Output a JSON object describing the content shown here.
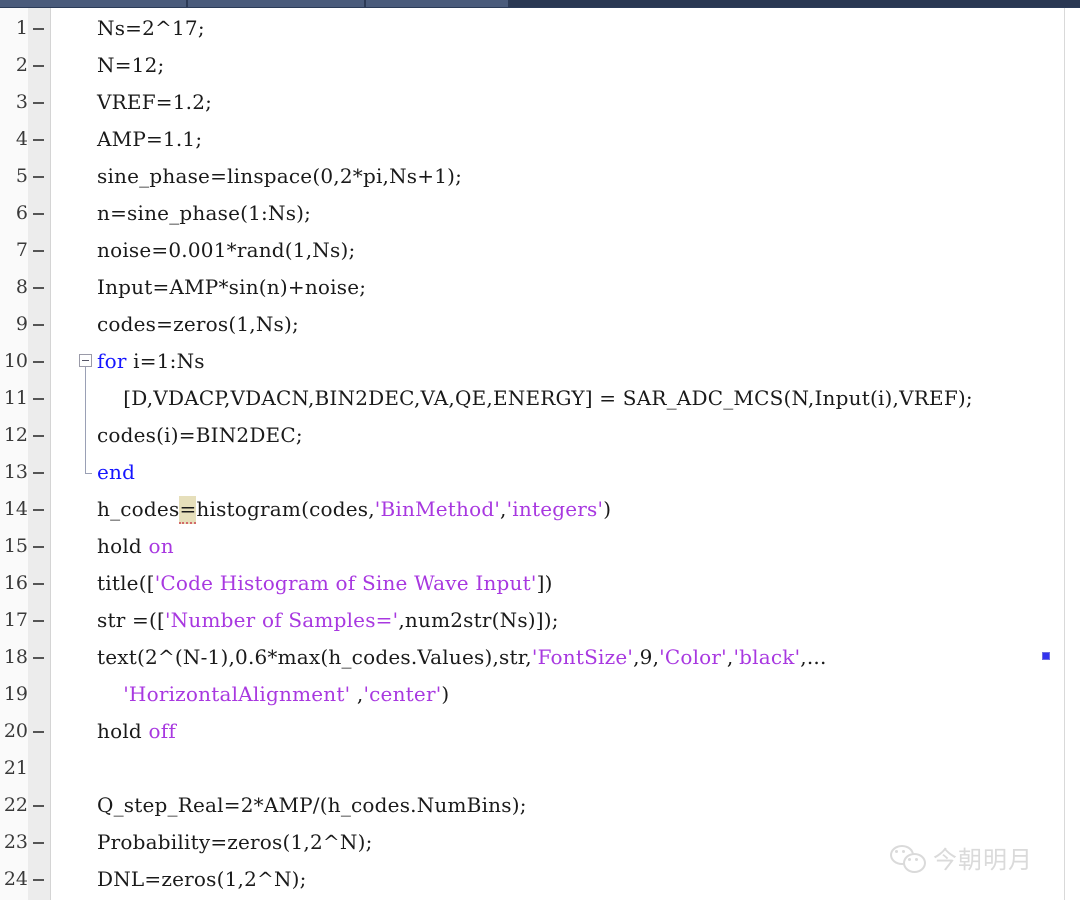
{
  "window": {
    "app": "MATLAB Editor",
    "toolbar_accent": "#485978",
    "toolbar_accent_dark": "#293752"
  },
  "editor": {
    "background": "#ffffff",
    "gutter_background": "#ececec",
    "keyword_color": "#1515ff",
    "string_color": "#a838e0",
    "text_color": "#1a1a1a",
    "highlight_background": "#e6dfbb",
    "error_underline_color": "#d26a6a"
  },
  "analyzer": {
    "marker_color": "#3333ee",
    "marker_label": "code-analyzer-marker"
  },
  "watermark": {
    "icon": "wechat-icon",
    "text": "今朝明月"
  },
  "lines": [
    {
      "n": "1",
      "dash": true,
      "indent": 0,
      "tokens": [
        {
          "t": "Ns=2^17;",
          "c": "plain"
        }
      ]
    },
    {
      "n": "2",
      "dash": true,
      "indent": 0,
      "tokens": [
        {
          "t": "N=12;",
          "c": "plain"
        }
      ]
    },
    {
      "n": "3",
      "dash": true,
      "indent": 0,
      "tokens": [
        {
          "t": "VREF=1.2;",
          "c": "plain"
        }
      ]
    },
    {
      "n": "4",
      "dash": true,
      "indent": 0,
      "tokens": [
        {
          "t": "AMP=1.1;",
          "c": "plain"
        }
      ]
    },
    {
      "n": "5",
      "dash": true,
      "indent": 0,
      "tokens": [
        {
          "t": "sine_phase=linspace(0,2*pi,Ns+1);",
          "c": "plain"
        }
      ]
    },
    {
      "n": "6",
      "dash": true,
      "indent": 0,
      "tokens": [
        {
          "t": "n=sine_phase(1:Ns);",
          "c": "plain"
        }
      ]
    },
    {
      "n": "7",
      "dash": true,
      "indent": 0,
      "tokens": [
        {
          "t": "noise=0.001*rand(1,Ns);",
          "c": "plain"
        }
      ]
    },
    {
      "n": "8",
      "dash": true,
      "indent": 0,
      "tokens": [
        {
          "t": "Input=AMP*sin(n)+noise;",
          "c": "plain"
        }
      ]
    },
    {
      "n": "9",
      "dash": true,
      "indent": 0,
      "tokens": [
        {
          "t": "codes=zeros(1,Ns);",
          "c": "plain"
        }
      ]
    },
    {
      "n": "10",
      "dash": true,
      "indent": 0,
      "tokens": [
        {
          "t": "for",
          "c": "kw"
        },
        {
          "t": " i=1:Ns",
          "c": "plain"
        }
      ]
    },
    {
      "n": "11",
      "dash": true,
      "indent": 0,
      "tokens": [
        {
          "t": "    [D,VDACP,VDACN,BIN2DEC,VA,QE,ENERGY] = SAR_ADC_MCS(N,Input(i),VREF);",
          "c": "plain"
        }
      ]
    },
    {
      "n": "12",
      "dash": true,
      "indent": 0,
      "tokens": [
        {
          "t": "codes(i)=BIN2DEC;",
          "c": "plain"
        }
      ]
    },
    {
      "n": "13",
      "dash": true,
      "indent": 0,
      "tokens": [
        {
          "t": "end",
          "c": "kw"
        }
      ]
    },
    {
      "n": "14",
      "dash": true,
      "indent": 0,
      "tokens": [
        {
          "t": "h_codes",
          "c": "plain"
        },
        {
          "t": "=",
          "c": "hl"
        },
        {
          "t": "histogram(codes,",
          "c": "plain"
        },
        {
          "t": "'BinMethod'",
          "c": "str"
        },
        {
          "t": ",",
          "c": "plain"
        },
        {
          "t": "'integers'",
          "c": "str"
        },
        {
          "t": ")",
          "c": "plain"
        }
      ]
    },
    {
      "n": "15",
      "dash": true,
      "indent": 0,
      "tokens": [
        {
          "t": "hold ",
          "c": "plain"
        },
        {
          "t": "on",
          "c": "str"
        }
      ]
    },
    {
      "n": "16",
      "dash": true,
      "indent": 0,
      "tokens": [
        {
          "t": "title([",
          "c": "plain"
        },
        {
          "t": "'Code Histogram of Sine Wave Input'",
          "c": "str"
        },
        {
          "t": "])",
          "c": "plain"
        }
      ]
    },
    {
      "n": "17",
      "dash": true,
      "indent": 0,
      "tokens": [
        {
          "t": "str =([",
          "c": "plain"
        },
        {
          "t": "'Number of Samples='",
          "c": "str"
        },
        {
          "t": ",num2str(Ns)]);",
          "c": "plain"
        }
      ]
    },
    {
      "n": "18",
      "dash": true,
      "indent": 0,
      "tokens": [
        {
          "t": "text(2^(N-1),0.6*max(h_codes.Values),str,",
          "c": "plain"
        },
        {
          "t": "'FontSize'",
          "c": "str"
        },
        {
          "t": ",9,",
          "c": "plain"
        },
        {
          "t": "'Color'",
          "c": "str"
        },
        {
          "t": ",",
          "c": "plain"
        },
        {
          "t": "'black'",
          "c": "str"
        },
        {
          "t": ",...",
          "c": "plain"
        }
      ]
    },
    {
      "n": "19",
      "dash": false,
      "indent": 0,
      "tokens": [
        {
          "t": "    ",
          "c": "plain"
        },
        {
          "t": "'HorizontalAlignment'",
          "c": "str"
        },
        {
          "t": " ,",
          "c": "plain"
        },
        {
          "t": "'center'",
          "c": "str"
        },
        {
          "t": ")",
          "c": "plain"
        }
      ]
    },
    {
      "n": "20",
      "dash": true,
      "indent": 0,
      "tokens": [
        {
          "t": "hold ",
          "c": "plain"
        },
        {
          "t": "off",
          "c": "str"
        }
      ]
    },
    {
      "n": "21",
      "dash": false,
      "indent": 0,
      "tokens": [
        {
          "t": "",
          "c": "plain"
        }
      ]
    },
    {
      "n": "22",
      "dash": true,
      "indent": 0,
      "tokens": [
        {
          "t": "Q_step_Real=2*AMP/(h_codes.NumBins);",
          "c": "plain"
        }
      ]
    },
    {
      "n": "23",
      "dash": true,
      "indent": 0,
      "tokens": [
        {
          "t": "Probability=zeros(1,2^N);",
          "c": "plain"
        }
      ]
    },
    {
      "n": "24",
      "dash": true,
      "indent": 0,
      "tokens": [
        {
          "t": "DNL=zeros(1,2^N);",
          "c": "plain"
        }
      ]
    }
  ],
  "fold_block": {
    "start_line": "10",
    "end_line": "13",
    "state": "expanded",
    "widget": "collapse-minus-box"
  }
}
